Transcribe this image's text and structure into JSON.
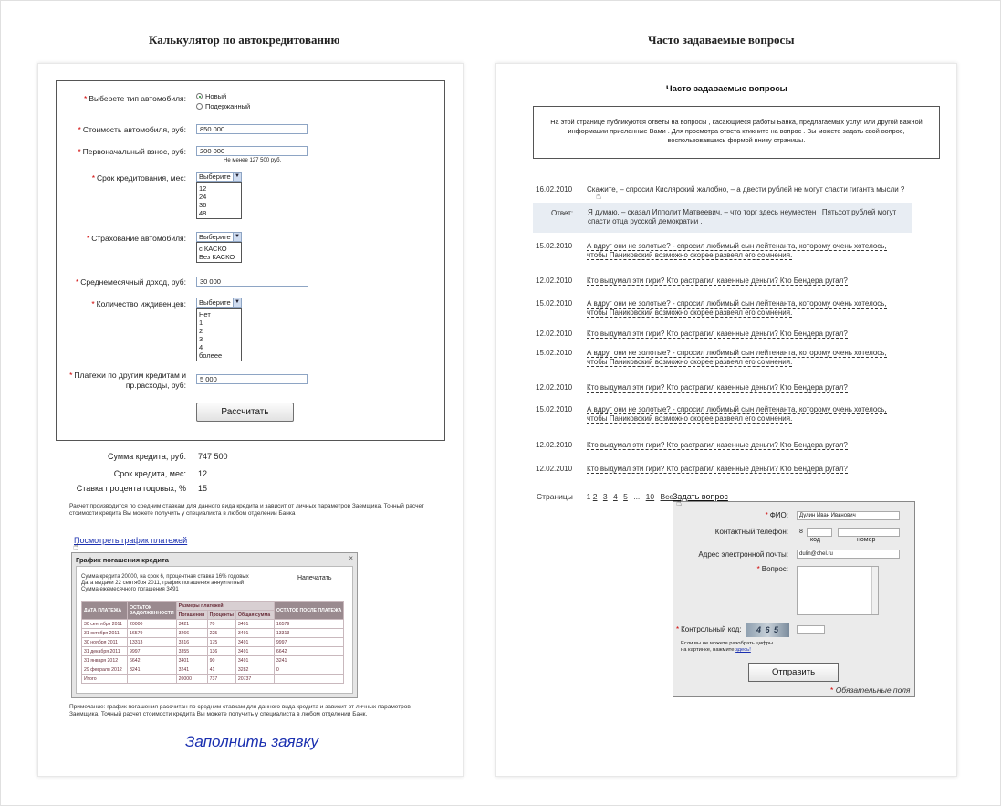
{
  "titles": {
    "calc": "Калькулятор по автокредитованию",
    "faq": "Часто задаваемые вопросы"
  },
  "calc": {
    "car_type_label": "Выберете тип автомобиля:",
    "car_type_new": "Новый",
    "car_type_used": "Подержанный",
    "price_label": "Стоимость автомобиля, руб:",
    "price_value": "850 000",
    "down_label": "Первоначальный взнос, руб:",
    "down_value": "200 000",
    "down_hint": "Не менее 127 500 руб.",
    "term_label": "Срок кредитования, мес:",
    "term_select": "Выберите",
    "term_options": [
      "12",
      "24",
      "36",
      "48"
    ],
    "insurance_label": "Страхование автомобиля:",
    "insurance_select": "Выберите",
    "insurance_options": [
      "с КАСКО",
      "Без КАСКО"
    ],
    "income_label": "Среднемесячный доход, руб:",
    "income_value": "30 000",
    "dependents_label": "Количество иждивенцев:",
    "dependents_select": "Выберите",
    "dependents_options": [
      "Нет",
      "1",
      "2",
      "3",
      "4",
      "болеее"
    ],
    "other_label_1": "Платежи по другим кредитам и",
    "other_label_2": "пр.расходы, руб:",
    "other_value": "5 000",
    "calc_button": "Рассчитать",
    "sum_label": "Сумма кредита, руб:",
    "sum_value": "747 500",
    "term_res_label": "Срок кредита, мес:",
    "term_res_value": "12",
    "rate_label": "Ставка процента годовых, %",
    "rate_value": "15",
    "disclaimer": "Расчет производится по средним ставкам для данного вида кредита и зависит от личных параметров Заемщика. Точный расчет стоимости кредита Вы можете получить у специалиста в любом отделении Банка",
    "schedule_link": "Посмотреть график платежей",
    "footnote": "Примечание: график погашения рассчитан по средним ставкам для данного вида кредита и зависит от личных параметров Заемщика. Точный расчет стоимости кредита Вы можете получить у специалиста в любом отделении Банк.",
    "apply_link": "Заполнить заявку"
  },
  "schedule": {
    "title": "График погашения кредита",
    "close": "×",
    "info_1": "Сумма кредита 20000, на срок 6, процентная ставка 16% годовых",
    "info_2": "Дата выдачи 22 сентября 2011, график погашения аннуитетный",
    "info_3": "Сумма ежемесячного погашения 3491",
    "print": "Напечатать",
    "headers": {
      "date": "ДАТА ПЛАТЕЖА",
      "rest": "ОСТАТОК ЗАДОЛЖЕННОСТИ",
      "sizes": "Размеры платежей",
      "repay": "Погашения",
      "interest": "Проценты",
      "total": "Общая сумма",
      "after": "ОСТАТОК ПОСЛЕ ПЛАТЕЖА"
    },
    "rows": [
      [
        "30 сентября 2011",
        "20000",
        "3421",
        "70",
        "3491",
        "16579"
      ],
      [
        "31 октября 2011",
        "16579",
        "3266",
        "225",
        "3491",
        "13313"
      ],
      [
        "30 ноября 2011",
        "13313",
        "3316",
        "175",
        "3491",
        "9997"
      ],
      [
        "31 декабря 2011",
        "9997",
        "3355",
        "136",
        "3491",
        "6642"
      ],
      [
        "31 января 2012",
        "6642",
        "3401",
        "90",
        "3491",
        "3241"
      ],
      [
        "29 февраля 2012",
        "3241",
        "3241",
        "41",
        "3282",
        "0"
      ],
      [
        "Итого",
        "",
        "20000",
        "737",
        "20737",
        ""
      ]
    ]
  },
  "faq": {
    "heading": "Часто задаваемые вопросы",
    "intro_1": "На этой странице публикуются ответы на вопросы , касающиеся работы Банка, предлагаемых услуг или другой важной",
    "intro_2": "информации присланные Вами . Для просмотра ответа ктикните на вопрос . Вы можете задать свой вопрос,",
    "intro_3": "воспользовавшись формой внизу страницы.",
    "answer_label": "Ответ:",
    "answer_1": "Я думаю, – сказал Ипполит Матвеевич, – что торг здесь неуместен ! Пятьсот рублей могут",
    "answer_2": "спасти отца русской демократии .",
    "questions": [
      {
        "date": "16.02.2010",
        "l1": "Скажите, – спросил Кислярский жалобно, – а двести рублей не могут спасти гиганта мысли ?",
        "l2": ""
      },
      {
        "date": "15.02.2010",
        "l1": "А вдруг они не золотые? - спросил любимый сын лейтенанта, которому очень хотелось,",
        "l2": "чтобы Паниковский возможно скорее развеял его сомнения."
      },
      {
        "date": "12.02.2010",
        "l1": "Кто выдумал эти гири? Кто растратил казенные деньги? Кто Бендера ругал?",
        "l2": ""
      },
      {
        "date": "15.02.2010",
        "l1": "А вдруг они не золотые? - спросил любимый сын лейтенанта, которому очень хотелось,",
        "l2": "чтобы Паниковский возможно скорее развеял его сомнения."
      },
      {
        "date": "12.02.2010",
        "l1": "Кто выдумал эти гири? Кто растратил казенные деньги? Кто Бендера ругал?",
        "l2": ""
      },
      {
        "date": "15.02.2010",
        "l1": "А вдруг они не золотые? - спросил любимый сын лейтенанта, которому очень хотелось,",
        "l2": "чтобы Паниковский возможно скорее развеял его сомнения."
      },
      {
        "date": "12.02.2010",
        "l1": "Кто выдумал эти гири? Кто растратил казенные деньги? Кто Бендера ругал?",
        "l2": ""
      },
      {
        "date": "15.02.2010",
        "l1": "А вдруг они не золотые? - спросил любимый сын лейтенанта, которому очень хотелось,",
        "l2": "чтобы Паниковский возможно скорее развеял его сомнения."
      },
      {
        "date": "12.02.2010",
        "l1": "Кто выдумал эти гири? Кто растратил казенные деньги? Кто Бендера ругал?",
        "l2": ""
      },
      {
        "date": "12.02.2010",
        "l1": "Кто выдумал эти гири? Кто растратил казенные деньги? Кто Бендера ругал?",
        "l2": ""
      }
    ],
    "pages_label": "Страницы",
    "pages": [
      "1",
      "2",
      "3",
      "4",
      "5",
      "...",
      "10",
      "Все"
    ],
    "ask_link": "Задать вопрос"
  },
  "form": {
    "fio_label": "ФИО:",
    "fio_value": "Дулин Иван Иванович",
    "phone_label": "Контактный телефон:",
    "phone_prefix": "8",
    "phone_code_caption": "код",
    "phone_number_caption": "номер",
    "email_label": "Адрес электронной почты:",
    "email_value": "dulin@chel.ru",
    "question_label": "Вопрос:",
    "captcha_label": "Контрольный код:",
    "captcha_text": "4 6 5",
    "captcha_hint_1": "Если вы не можете разобрать цифры",
    "captcha_hint_2": "на картинке, нажмите",
    "captcha_hint_link": "здесь!",
    "send_button": "Отправить",
    "required_note": "Обязательные поля"
  }
}
